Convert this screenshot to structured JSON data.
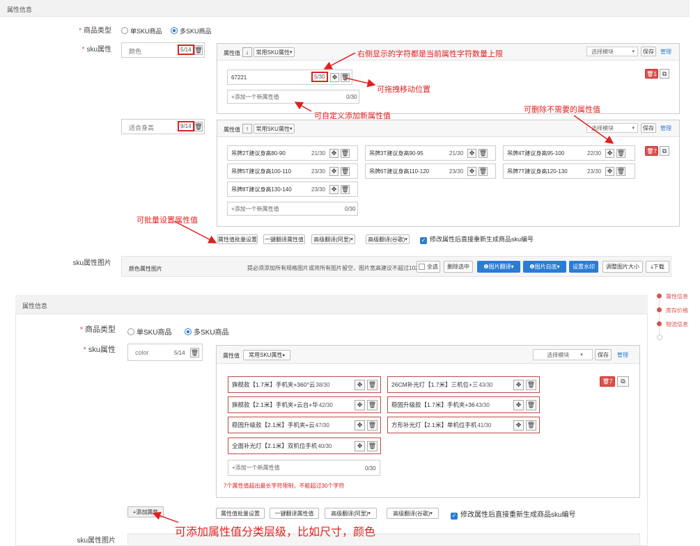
{
  "top": {
    "panel_title": "属性信息",
    "product_type": {
      "label": "商品类型",
      "single": "单SKU商品",
      "multi": "多SKU商品"
    },
    "sku_label": "sku属性",
    "attrs": [
      {
        "name": "颜色",
        "count": "5/14",
        "header": {
          "label": "属性值",
          "dir": "↓",
          "common": "常用SKU属性"
        },
        "values": [
          {
            "text": "67221",
            "count": "5/30"
          }
        ],
        "add": {
          "placeholder": "+添加一个新属性值",
          "count": "0/30"
        },
        "template": "选择模块",
        "save": "保存",
        "manage": "管理",
        "del_count": "1"
      },
      {
        "name": "适合身高",
        "count": "9/14",
        "header": {
          "label": "属性值",
          "dir": "↑",
          "common": "常用SKU属性"
        },
        "values": [
          {
            "text": "吊牌2T建议身高80-90",
            "count": "21/30"
          },
          {
            "text": "吊牌3T建议身高90-95",
            "count": "21/30"
          },
          {
            "text": "吊牌4T建议身高95-100",
            "count": "22/30"
          },
          {
            "text": "吊牌5T建议身高100-110",
            "count": "23/30"
          },
          {
            "text": "吊牌6T建议身高110-120",
            "count": "23/30"
          },
          {
            "text": "吊牌7T建议身高120-130",
            "count": "23/30"
          },
          {
            "text": "吊牌8T建议身高130-140",
            "count": "23/30"
          }
        ],
        "add": {
          "placeholder": "+添加一个新属性值",
          "count": "0/30"
        },
        "template": "选择模块",
        "save": "保存",
        "manage": "管理",
        "del_count": "7"
      }
    ],
    "bottom_btns": [
      "属性值批量设置",
      "一键翻译属性值",
      "高级翻译(阿里)",
      "高级翻译(谷歌)"
    ],
    "regen_label": "修改属性后直接重新生成商品sku编号",
    "img": {
      "label": "sku属性图片",
      "row_label": "颜色属性图片",
      "hint": "提必须添加所有规格图片或将所有图片留空，图片宽高建议不超过1024",
      "select_all": "全选",
      "del_sel": "删除选中",
      "trans": "图片翻译",
      "lib": "图片白底",
      "watermark": "设置水印",
      "resize": "调整图片大小",
      "download": "下载"
    },
    "notes": {
      "n1": "右侧显示的字符都是当前属性字符数量上限",
      "n2": "可拖拽移动位置",
      "n3": "可自定义添加新属性值",
      "n4": "可删除不需要的属性值",
      "n5": "可批量设置属性值"
    }
  },
  "bottom": {
    "panel_title": "属性信息",
    "product_type": {
      "label": "商品类型",
      "single": "单SKU商品",
      "multi": "多SKU商品"
    },
    "sku_label": "sku属性",
    "attr": {
      "name": "color",
      "count": "5/14",
      "header": {
        "label": "属性值",
        "common": "常用SKU属性"
      },
      "values": [
        {
          "text": "旗舰款【1.7米】手机夹+360°云",
          "count": "38/30"
        },
        {
          "text": "26CM补光灯【1.7米】三机位+三",
          "count": "43/30"
        },
        {
          "text": "旗舰款【2.1米】手机夹+云台+华",
          "count": "42/30"
        },
        {
          "text": "稳固升级款【1.7米】手机夹+36",
          "count": "43/30"
        },
        {
          "text": "稳固升级款【2.1米】手机夹+云",
          "count": "47/30"
        },
        {
          "text": "方形补光灯【2.1米】单机位手机",
          "count": "41/30"
        },
        {
          "text": "全面补光灯【2.1米】双机位手机",
          "count": "40/30"
        }
      ],
      "add": {
        "placeholder": "+添加一个新属性值",
        "count": "0/30"
      },
      "warning": "7个属性值超出最长字符限制，不能超过30个字符",
      "template": "选择模块",
      "save": "保存",
      "manage": "管理",
      "del_count": "7"
    },
    "add_attr": "+添加属性",
    "bottom_btns": [
      "属性值批量设置",
      "一键翻译属性值",
      "高级翻译(阿里)",
      "高级翻译(谷歌)"
    ],
    "regen_label": "修改属性后直接重新生成商品sku编号",
    "img_label": "sku属性图片",
    "note": "可添加属性值分类层级，比如尺寸，颜色",
    "sidenav": [
      "属性信息",
      "库存价格",
      "物流信息"
    ]
  },
  "colors": {
    "accent": "#2b7cd3",
    "annotation": "#e02020",
    "danger": "#d9534f"
  }
}
